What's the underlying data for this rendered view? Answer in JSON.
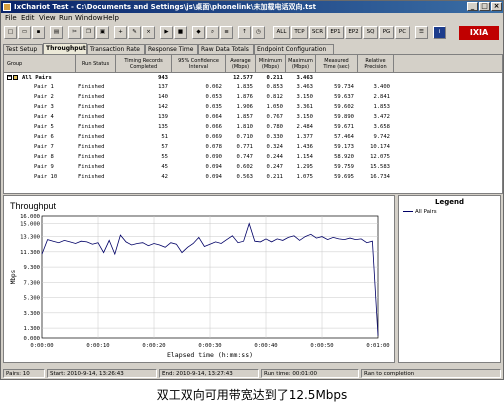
{
  "window": {
    "title": "IxChariot Test - C:\\Documents and Settings\\js\\桌面\\phonelink\\未加载电话双向.tst"
  },
  "menu": [
    "File",
    "Edit",
    "View",
    "Run",
    "Window",
    "Help"
  ],
  "toolbar": {
    "text_buttons": [
      "ALL",
      "TCP",
      "SCR",
      "EP1",
      "EP2",
      "SQ",
      "PG",
      "PC"
    ],
    "logo": "IXIA"
  },
  "tabs": [
    "Test Setup",
    "Throughput",
    "Transaction Rate",
    "Response Time",
    "Raw Data Totals",
    "Endpoint Configuration"
  ],
  "active_tab": "Throughput",
  "grid": {
    "headers": [
      "Group",
      "Run Status",
      "Timing Records\nCompleted",
      "95% Confidence\nInterval",
      "Average\n(Mbps)",
      "Minimum\n(Mbps)",
      "Maximum\n(Mbps)",
      "Measured\nTime (sec)",
      "Relative\nPrecision"
    ],
    "total": {
      "group": "All Pairs",
      "timing": "943",
      "average": "12.577",
      "minimum": "0.211",
      "maximum": "3.463"
    },
    "rows": [
      [
        "Pair 1",
        "Finished",
        "137",
        "0.062",
        "1.835",
        "0.853",
        "3.463",
        "59.734",
        "3.400"
      ],
      [
        "Pair 2",
        "Finished",
        "140",
        "0.053",
        "1.876",
        "0.812",
        "3.150",
        "59.637",
        "2.841"
      ],
      [
        "Pair 3",
        "Finished",
        "142",
        "0.035",
        "1.906",
        "1.050",
        "3.361",
        "59.602",
        "1.853"
      ],
      [
        "Pair 4",
        "Finished",
        "139",
        "0.064",
        "1.857",
        "0.767",
        "3.150",
        "59.890",
        "3.472"
      ],
      [
        "Pair 5",
        "Finished",
        "135",
        "0.066",
        "1.810",
        "0.780",
        "2.484",
        "59.671",
        "3.658"
      ],
      [
        "Pair 6",
        "Finished",
        "51",
        "0.069",
        "0.710",
        "0.330",
        "1.377",
        "57.464",
        "9.742"
      ],
      [
        "Pair 7",
        "Finished",
        "57",
        "0.078",
        "0.771",
        "0.324",
        "1.436",
        "59.173",
        "10.174"
      ],
      [
        "Pair 8",
        "Finished",
        "55",
        "0.090",
        "0.747",
        "0.244",
        "1.154",
        "58.920",
        "12.075"
      ],
      [
        "Pair 9",
        "Finished",
        "45",
        "0.094",
        "0.602",
        "0.247",
        "1.295",
        "59.759",
        "15.583"
      ],
      [
        "Pair 10",
        "Finished",
        "42",
        "0.094",
        "0.563",
        "0.211",
        "1.075",
        "59.695",
        "16.734"
      ]
    ]
  },
  "chart_data": {
    "type": "line",
    "title": "Throughput",
    "ylabel": "Mbps",
    "xlabel": "Elapsed time (h:mm:ss)",
    "ylim": [
      0,
      16.0
    ],
    "yticks": [
      "16.000",
      "15.000",
      "13.300",
      "11.300",
      "9.300",
      "7.300",
      "5.300",
      "3.300",
      "1.300",
      "0.000"
    ],
    "xlim_seconds": [
      0,
      60
    ],
    "xticks": [
      "0:00:00",
      "0:00:10",
      "0:00:20",
      "0:00:30",
      "0:00:40",
      "0:00:50",
      "0:01:00"
    ],
    "grid": true,
    "series": [
      {
        "name": "All Pairs",
        "color": "#000066",
        "x": [
          0,
          1,
          2,
          3,
          4,
          5,
          6,
          7,
          8,
          9,
          10,
          11,
          12,
          13,
          14,
          15,
          16,
          17,
          18,
          19,
          20,
          21,
          22,
          23,
          24,
          25,
          26,
          27,
          28,
          29,
          30,
          31,
          32,
          33,
          34,
          35,
          36,
          37,
          38,
          39,
          40,
          41,
          42,
          43,
          44,
          45,
          46,
          47,
          48,
          49,
          50,
          51,
          52,
          53,
          54,
          55,
          56,
          57,
          58,
          59,
          60
        ],
        "y": [
          11.0,
          12.9,
          12.7,
          12.5,
          12.8,
          12.6,
          12.4,
          12.7,
          12.6,
          12.3,
          12.5,
          11.2,
          12.8,
          11.0,
          13.5,
          12.6,
          12.2,
          12.4,
          12.5,
          12.1,
          12.4,
          12.2,
          11.9,
          12.5,
          12.3,
          11.2,
          11.9,
          12.4,
          13.2,
          12.0,
          12.3,
          12.6,
          12.4,
          12.9,
          13.4,
          12.5,
          12.7,
          15.0,
          12.7,
          12.6,
          13.0,
          12.6,
          13.0,
          12.8,
          13.2,
          13.4,
          12.8,
          13.3,
          13.6,
          13.1,
          13.3,
          12.9,
          13.2,
          13.0,
          12.9,
          13.1,
          12.9,
          13.0,
          12.5,
          12.7,
          0.3
        ]
      }
    ]
  },
  "legend": {
    "title": "Legend",
    "item": "All Pairs"
  },
  "status": {
    "pairs": "Pairs: 10",
    "start": "Start: 2010-9-14, 13:26:43",
    "end": "End: 2010-9-14, 13:27:43",
    "run_time": "Run time: 00:01:00",
    "completion": "Ran to completion"
  },
  "caption": "双工双向可用带宽达到了12.5Mbps"
}
